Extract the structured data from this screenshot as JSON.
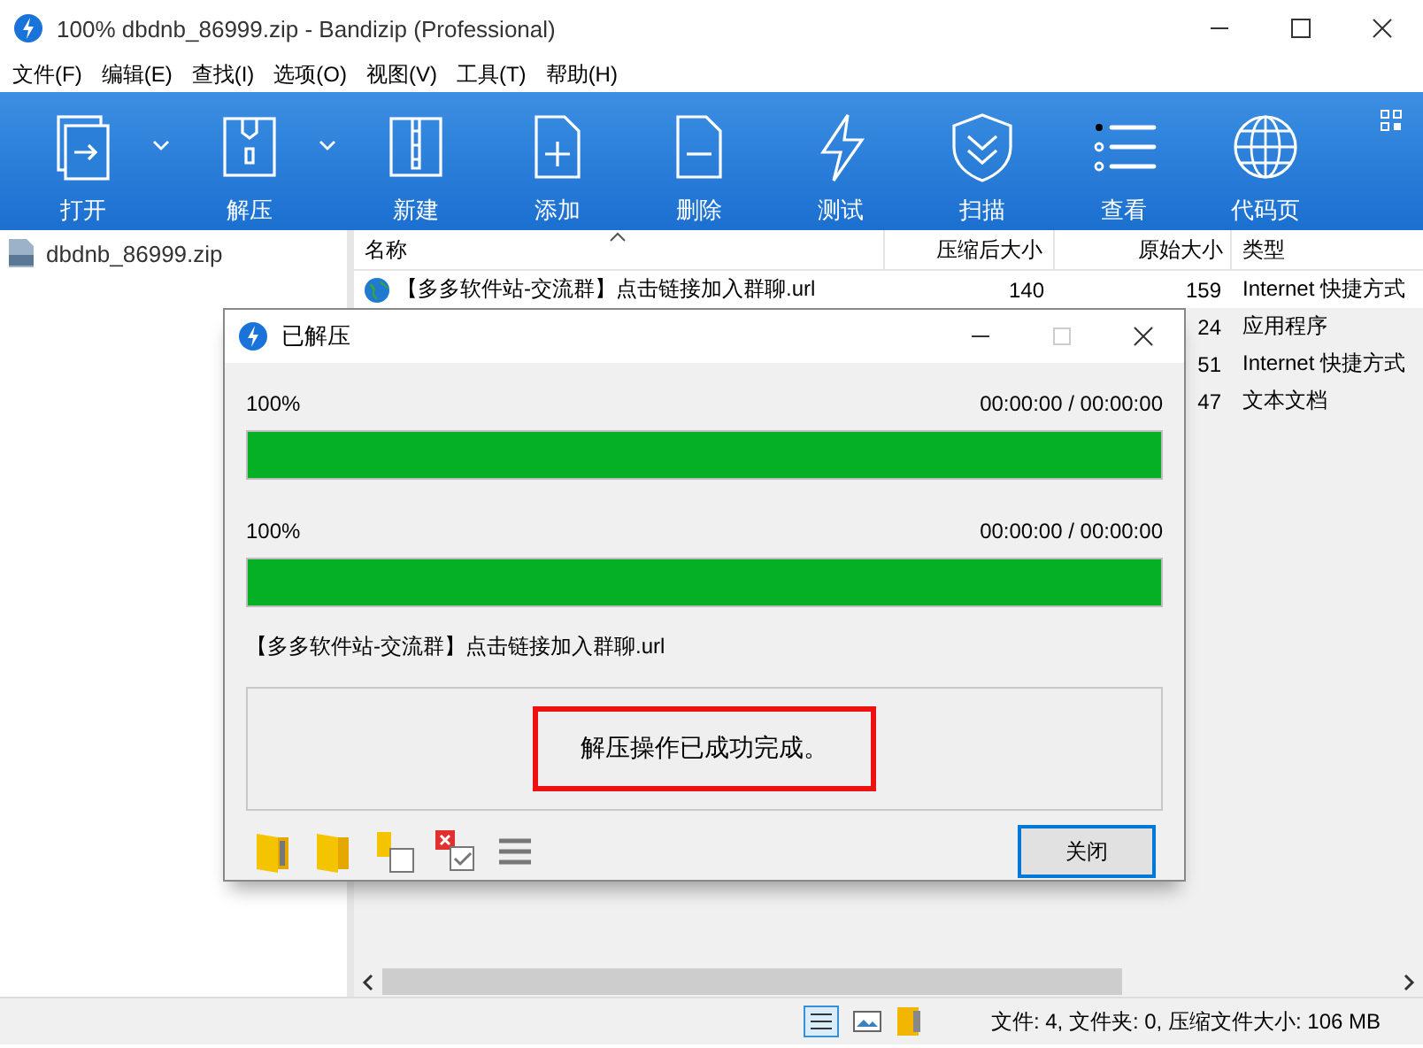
{
  "window": {
    "title": "100% dbdnb_86999.zip - Bandizip (Professional)"
  },
  "menu": [
    "文件(F)",
    "编辑(E)",
    "查找(I)",
    "选项(O)",
    "视图(V)",
    "工具(T)",
    "帮助(H)"
  ],
  "toolbar": [
    {
      "label": "打开",
      "kind": "open",
      "dropdown": true
    },
    {
      "label": "解压",
      "kind": "extract",
      "dropdown": true
    },
    {
      "label": "新建",
      "kind": "new",
      "dropdown": false
    },
    {
      "label": "添加",
      "kind": "add",
      "dropdown": false
    },
    {
      "label": "删除",
      "kind": "delete",
      "dropdown": false
    },
    {
      "label": "测试",
      "kind": "test",
      "dropdown": false
    },
    {
      "label": "扫描",
      "kind": "scan",
      "dropdown": false
    },
    {
      "label": "查看",
      "kind": "view",
      "dropdown": false
    },
    {
      "label": "代码页",
      "kind": "codepage",
      "dropdown": false
    }
  ],
  "sidebar": {
    "items": [
      {
        "label": "dbdnb_86999.zip",
        "selected": false
      }
    ]
  },
  "table": {
    "columns": [
      "名称",
      "压缩后大小",
      "原始大小",
      "类型"
    ],
    "rows": [
      {
        "name": "【多多软件站-交流群】点击链接加入群聊.url",
        "packed": "140",
        "size": "159",
        "type": "Internet 快捷方式"
      },
      {
        "size": "24",
        "type": "应用程序"
      },
      {
        "size": "51",
        "type": "Internet 快捷方式"
      },
      {
        "size": "47",
        "type": "文本文档"
      }
    ]
  },
  "dialog": {
    "title": "已解压",
    "progress": [
      {
        "percent": "100%",
        "time": "00:00:00 / 00:00:00",
        "level": 1
      },
      {
        "percent": "100%",
        "time": "00:00:00 / 00:00:00",
        "level": 1
      }
    ],
    "current_file": "【多多软件站-交流群】点击链接加入群聊.url",
    "message": "解压操作已成功完成。",
    "close_button": "关闭"
  },
  "status_bar": {
    "text": "文件: 4, 文件夹: 0, 压缩文件大小: 106 MB"
  }
}
